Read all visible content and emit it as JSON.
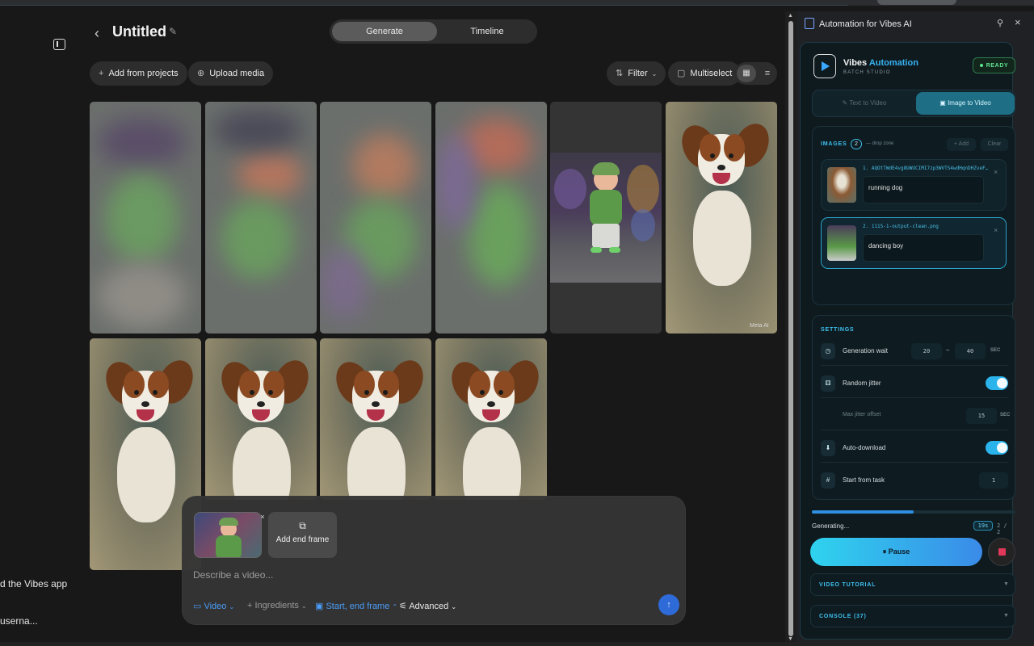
{
  "left_panel": {
    "text_line_1": "d the Vibes app",
    "text_line_2": "userna..."
  },
  "header": {
    "back_icon": "chevron-left-icon",
    "title": "Untitled",
    "edit_icon": "pencil-icon",
    "tabs": [
      {
        "label": "Generate",
        "active": true
      },
      {
        "label": "Timeline",
        "active": false
      }
    ]
  },
  "toolbar": {
    "add_from_projects": "Add from projects",
    "upload_media": "Upload media",
    "filter": "Filter",
    "multiselect": "Multiselect"
  },
  "gallery": {
    "watermark": "Meta AI"
  },
  "composer": {
    "add_end_frame": "Add end frame",
    "placeholder": "Describe a video...",
    "video": "Video",
    "ingredients": "Ingredients",
    "start_end_frame": "Start, end frame",
    "advanced": "Advanced",
    "accent_color": "#4a9cf7"
  },
  "extension": {
    "window_title": "Automation for Vibes AI",
    "brand_main": "Vibes",
    "brand_accent": "Automation",
    "brand_sub": "BATCH STUDIO",
    "status": "READY",
    "modes": [
      "Text to Video",
      "Image to Video"
    ],
    "images_label": "IMAGES",
    "images_count": "2",
    "drop_zone": "— drop zone",
    "add": "+ Add",
    "clear": "Clear",
    "items": [
      {
        "filename": "1. AQOtTWdE4vg8UWUCIMI7zp3WVTS4wdHqnDHZveFu...",
        "prompt": "running dog",
        "selected": false
      },
      {
        "filename": "2. 1115-1-output-clean.png",
        "prompt": "dancing boy",
        "selected": true
      }
    ],
    "settings_label": "SETTINGS",
    "settings": {
      "generation_wait": "Generation wait",
      "wait_min": "20",
      "wait_dash": "–",
      "wait_max": "40",
      "unit": "SEC",
      "random_jitter": "Random jitter",
      "random_jitter_on": true,
      "max_jitter_offset": "Max jitter offset",
      "jitter_value": "15",
      "auto_download": "Auto-download",
      "auto_download_on": true,
      "start_from_task": "Start from task",
      "start_value": "1"
    },
    "progress": 0.5,
    "generating": "Generating...",
    "timer": "19s",
    "count": "2 / 2",
    "pause": "Pause",
    "video_tutorial": "VIDEO TUTORIAL",
    "console": "CONSOLE (37)",
    "accent_color": "#3ec0ef"
  }
}
